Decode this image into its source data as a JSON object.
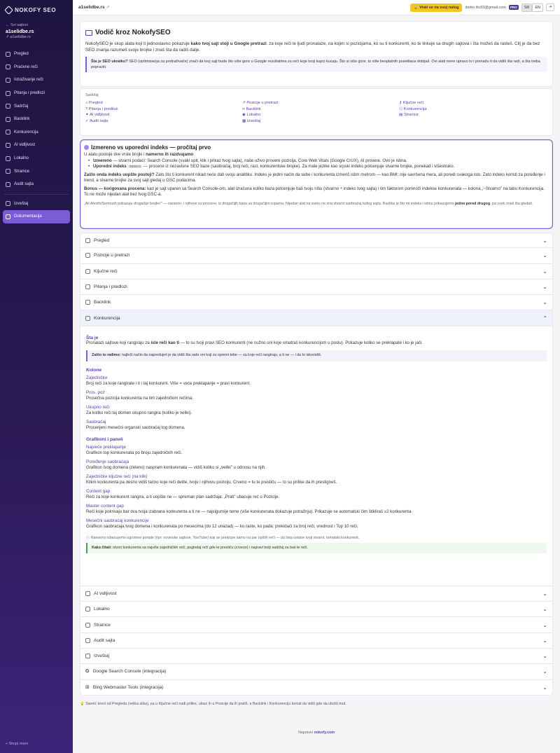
{
  "sidebar": {
    "brand": "NOKOFY SEO",
    "back_link": "← Svi sajtovi",
    "site_name": "a1selidbe.rs",
    "site_url": "↗ a1selidbe.rs",
    "nav": [
      "Pregled",
      "Praćene reči",
      "Istraživanje reči",
      "Pitanja i predlozi",
      "Sadržaj",
      "Backlink",
      "Konkurencija",
      "AI vidljivost",
      "Lokalno",
      "Stranice",
      "Audit sajta"
    ],
    "nav2": [
      "Izveštaj",
      "Dokumentacija"
    ],
    "collapse": "« Skupi meni"
  },
  "topbar": {
    "crumb": "a1selidbe.rs",
    "return_btn": "Vrati se na svoj nalog",
    "email": "darko.ilic83@gmail.com",
    "badge": "PRO",
    "lang_sr": "SR",
    "lang_en": "EN",
    "logout_icon": "logout-icon"
  },
  "intro": {
    "title": "Vodič kroz NokofySEO",
    "p1_a": "NokofySEO je skup alata koji ti jednostavno pokazuje ",
    "p1_b": "kako tvoj sajt stoji u Google pretrazi",
    "p1_c": ": za koje reči te ljudi pronalaze, na kojim si pozicijama, ko su ti konkurenti, ko te linkuje sa drugih sajtova i šta možeš da rasteš. Cilj je da bez SEO znanja razumeš svoje brojke i znaš šta da radiš dalje.",
    "note_b": "Šta je SEO ukratko?",
    "note": " SEO (optimizacija za pretraživače) znači da tvoj sajt bude što više gore u Google rezultatima za reči koje tvoji kupci kucaju. Što si više gore, to više besplatnih posetilaca dobijaš. Ovi alati mere upravo to i pomažu ti da vidiš šta radi, a šta treba popraviti."
  },
  "toc": {
    "title": "Sadržaj",
    "items": [
      "Pregled",
      "Pozicije u pretrazi",
      "Ključne reči",
      "Pitanja i predlozi",
      "Backlink",
      "Konkurencija",
      "AI vidljivost",
      "Lokalno",
      "Stranice",
      "Audit sajta",
      "Izveštaj"
    ]
  },
  "measured": {
    "title": "Izmereno vs uporedni indeks — pročitaj prvo",
    "lead_a": "U alatu postoje dve vrste brojki i ",
    "lead_b": "namerno ih razdvajamo",
    "lead_c": ":",
    "li1_b": "Izmereno",
    "li1": " — stvarni podaci: Search Console (svaki upit, klik i prikaz tvog sajta), naše uživo provere pozicija, Core Web Vitals (Google CrUX), AI provere. Ovo je istina.",
    "li2_b": "Uporedni indeks",
    "li2_tag": "INDEKS",
    "li2": " — procene iz nezavisne SEO baze (saobraćaj, broj reči, rast, konkurentske brojke). Za male jezike kao srpski indeks potcenjuje stvarne brojke, ponekad i višestruko.",
    "p2_b": "Zašto onda indeks uopšte postoji?",
    "p2": " Zato što ti konkurent nikad neće dati svoju analitiku. Indeks je jedini način da sebe i konkurenta izmeriš istim metrom — kao BMI: nije savršena mera, ali poredi svakoga isto. Zato indeks koristi za poređenje i trend, a stvarne brojke za svoj sajt gledaj u GSC podacima.",
    "p3_b": "Bonus — korigovana procena:",
    "p3": " kad je sajt uparen sa Search Console-om, alat izračuna koliko baza potcenjuje baš tvoju nišu (stvarno ÷ indeks tvog sajta) i tim faktorom pomnoži indekse konkurenata — kolona „~Stvarno\" na tabu Konkurencija. To ne može nijedan alat bez tvog GSC-a.",
    "p4": "„Ali Ahrefs/Semrush pokazuju drugačije brojke!\" — naravno: i njihove su procene, iz drugačijih baza sa drugačijim rupama. Nijedan alat na svetu ne zna stvarni saobraćaj tuđeg sajta. Razlika je što mi indeks i istinu prikazujemo ",
    "p4_b": "jedno pored drugog",
    "p4_c": ", pa uvek znaš šta gledaš."
  },
  "accordion": {
    "before": [
      "Pregled",
      "Pozicije u pretrazi",
      "Ključne reči",
      "Pitanja i predlozi",
      "Backlink"
    ],
    "open": "Konkurencija",
    "after": [
      "AI vidljivost",
      "Lokalno",
      "Stranice",
      "Audit sajta",
      "Izveštaj",
      "Google Search Console (integracija)",
      "Bing Webmaster Tools (integracija)"
    ]
  },
  "konkurencija": {
    "what_h": "Šta je",
    "what_a": "Pronalazi sajtove koji rangiraju za ",
    "what_b": "iste reči kao ti",
    "what_c": " — to su tvoji pravi SEO konkurenti (ne nužno oni koje smatraš konkurencijom u poslu). Pokazuje koliko se preklapate i ko je jači.",
    "why_b": "Zašto to radimo:",
    "why": " najbrži način da napreduješ je da vidiš šta rade oni koji su opremi tebe — za koje reči rangiraju, a ti ne — i da to iskoristiš.",
    "cols_h": "Kolone",
    "cols": [
      {
        "t": "Zajedničke",
        "d": "Broj reči za koje rangirate i ti i taj konkurent. Više = veće preklapanje = pravi konkurent."
      },
      {
        "t": "Pros. poz",
        "d": "Prosečna pozicija konkurenta na tim zajedničkim rečima."
      },
      {
        "t": "Ukupno reči",
        "d": "Za koliko reči taj domen ukupno rangira (koliko je veliki)."
      },
      {
        "t": "Saobraćaj",
        "d": "Procenjeni mesečni organski saobraćaj tog domena."
      }
    ],
    "graphs_h": "Grafikoni i paneli",
    "graphs": [
      {
        "t": "Najveće preklapanje",
        "d": "Grafikon top konkurenata po broju zajedničkih reči."
      },
      {
        "t": "Poređenje saobraćaja",
        "d": "Grafikon tvog domena (zeleno) naspram konkurenata — vidiš koliko si „veliki\" u odnosu na njih."
      },
      {
        "t": "Zajedničke ključne reči (na klik)",
        "d": "Klikni konkurenta pa desno vidiš tačno koje reči delite, tvoju i njihovu poziciju. Crveno = tu te prestiču — to su prilike da ih prestigneš."
      },
      {
        "t": "Content gap",
        "d": "Reči za koje konkurent rangira, a ti uopšte ne — spreman plan sadržaja: „Prati\" ubacuje reč u Pozicije."
      },
      {
        "t": "Master content gap",
        "d": "Reči koje pokrivaju bar dva tvoja izabrana konkurenta a ti ne — najsigurnije teme (više konkurenata dokazuje potražnju). Prikazuje se automatski čim štikliraš ≥2 konkurenta."
      },
      {
        "t": "Mesečni saobraćaj konkurencije",
        "d": "Grafikon saobraćaja tvog domena i konkurenata po mesecima (do 12 unazad) — ko raste, ko pada; prekidači za broj reči, vrednost i Top 10 reči."
      }
    ],
    "footnote": "ⓘ Namerno izbacujemo ogromne portale (npr. novinske sajtove, YouTube) koji se preklope samo na par opštih reči — da lista ostane tvoji stvarni, tematski konkurenti.",
    "how_b": "Kako čitati:",
    "how": " otvori konkurenta sa najviše zajedničkih reči, pogledaj reči gde te prestiču (crveno) i napravi bolji sadržaj za baš te reči."
  },
  "tip": "💡 Saveti: kreni od Pregleda (velika slika), pa u Ključne reči nađi prilike, ubaci ih u Pozicije da ih pratiš, a Backlink i Konkurenciju koristi da vidiš gde da uložiš trud.",
  "footer_a": "Napravio ",
  "footer_b": "nokofy.com"
}
